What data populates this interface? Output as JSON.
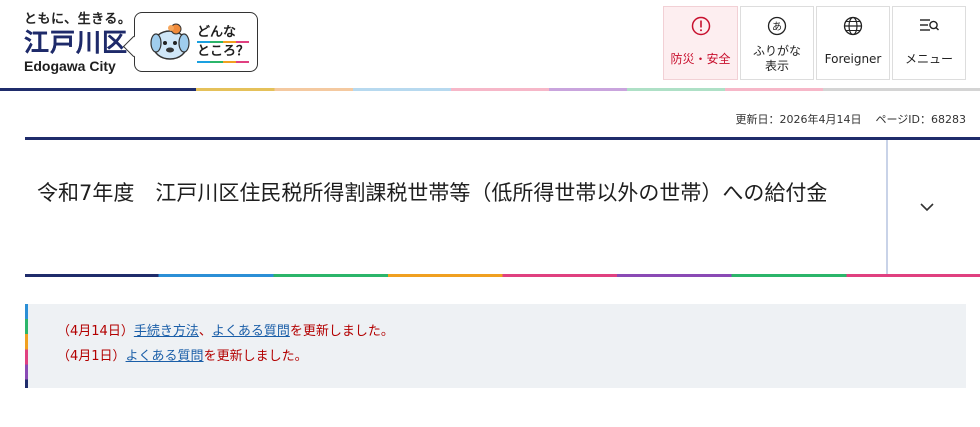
{
  "header": {
    "tagline": "ともに、生きる。",
    "logo_kanji": "江戸川区",
    "logo_en": "Edogawa City",
    "mascot_text_line1": "どんな",
    "mascot_text_line2": "ところ？",
    "nav": [
      {
        "label": "防災・安全",
        "icon": "exclamation-circle-icon",
        "color": "#c8102e"
      },
      {
        "label_line1": "ふりがな",
        "label_line2": "表示",
        "icon": "hiragana-a-circle-icon"
      },
      {
        "label": "Foreigner",
        "icon": "globe-icon"
      },
      {
        "label": "メニュー",
        "icon": "menu-search-icon"
      }
    ]
  },
  "meta": {
    "updated": "更新日：2026年4月14日",
    "page_id": "ページID：68283"
  },
  "page": {
    "title": "令和7年度　江戸川区住民税所得割課税世帯等（低所得世帯以外の世帯）への給付金"
  },
  "notice": {
    "line1": {
      "prefix": "（4月14日）",
      "link1": "手続き方法",
      "sep": "、",
      "link2": "よくある質問",
      "suffix": "を更新しました。"
    },
    "line2": {
      "prefix": "（4月1日）",
      "link1": "よくある質問",
      "suffix": "を更新しました。"
    }
  },
  "colors": {
    "brand_navy": "#1f2c6b",
    "emergency_red": "#c8102e",
    "notice_red": "#b30000",
    "link_blue": "#1a5ea8",
    "notice_bg": "#eef1f4"
  }
}
